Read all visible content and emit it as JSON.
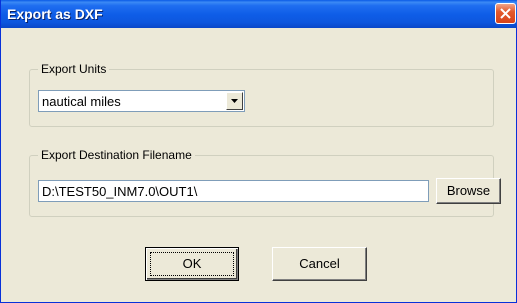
{
  "window": {
    "title": "Export as DXF"
  },
  "units_group": {
    "label": "Export Units",
    "selected": "nautical miles"
  },
  "dest_group": {
    "label": "Export Destination Filename",
    "filename": "D:\\TEST50_INM7.0\\OUT1\\",
    "browse_label": "Browse"
  },
  "buttons": {
    "ok_label": "OK",
    "cancel_label": "Cancel"
  },
  "icons": {
    "close": "close-icon",
    "dropdown": "chevron-down-icon"
  }
}
